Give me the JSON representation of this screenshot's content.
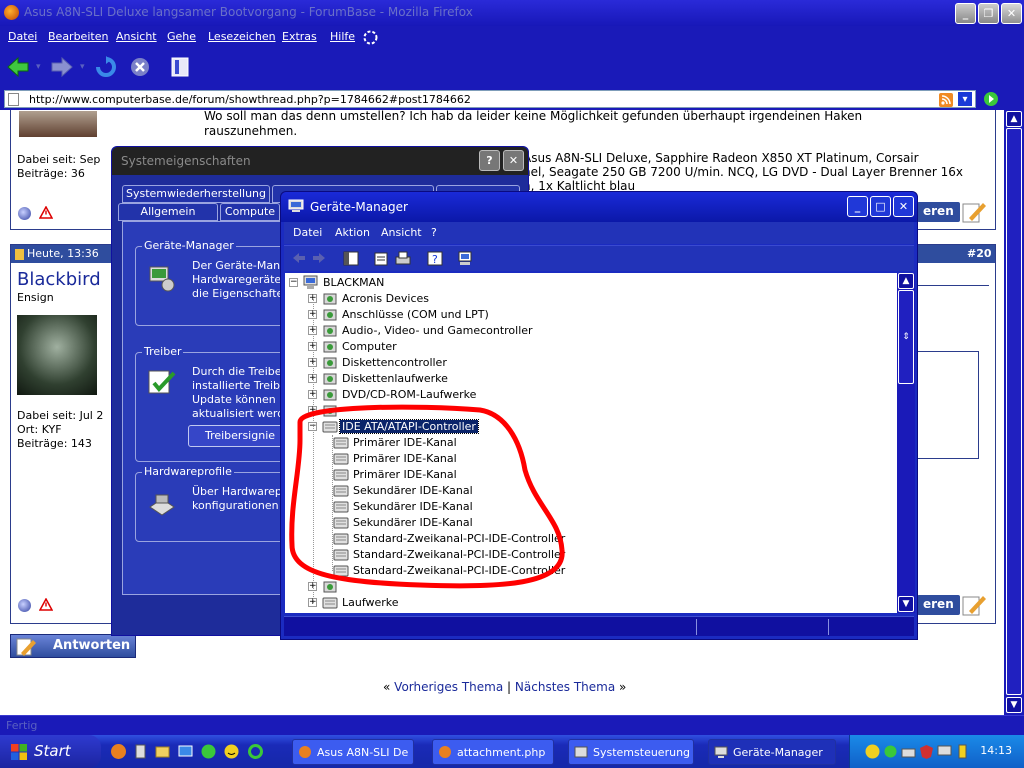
{
  "browser": {
    "title": "Asus A8N-SLI Deluxe langsamer Bootvorgang - ForumBase - Mozilla Firefox",
    "menu": [
      "Datei",
      "Bearbeiten",
      "Ansicht",
      "Gehe",
      "Lesezeichen",
      "Extras",
      "Hilfe"
    ],
    "url": "http://www.computerbase.de/forum/showthread.php?p=1784662#post1784662",
    "status": "Fertig"
  },
  "page": {
    "post1_text_lines": [
      "Wo soll man das denn umstellen? Ich hab da leider keine Möglichkeit gefunden überhaupt irgendeinen Haken",
      "rauszunehmen."
    ],
    "post1_user_lines": [
      "Dabei seit: Sep",
      "Beiträge: 36"
    ],
    "post1_sig_lines": [
      "Asus A8N-SLI Deluxe, Sapphire Radeon X850 XT Platinum, Corsair",
      "nel, Seagate 250 GB 7200 U/min. NCQ, LG DVD - Dual Layer Brenner 16x",
      "n, 1x Kaltlicht blau"
    ],
    "post2_date": "Heute, 13:36",
    "post2_number": "#20",
    "post2_username": "Blackbird",
    "post2_rank": "Ensign",
    "post2_user_lines": [
      "Dabei seit: Jul 2",
      "Ort: KYF",
      "Beiträge: 143"
    ],
    "edit_label": "eren",
    "reply_label": "Antworten",
    "nav_prev": "Vorheriges Thema",
    "nav_sep": "|",
    "nav_next": "Nächstes Thema",
    "nav_left_mark": "«",
    "nav_right_mark": "»"
  },
  "sysprops": {
    "title": "Systemeigenschaften",
    "tabs_row1": [
      "Systemwiederherstellung"
    ],
    "tabs_row2": [
      "Allgemein",
      "Compute"
    ],
    "groups": [
      {
        "legend": "Geräte-Manager",
        "lines": [
          "Der Geräte-Manag",
          "Hardwaregeräte a",
          "die Eigenschaften"
        ]
      },
      {
        "legend": "Treiber",
        "lines": [
          "Durch die Treibers",
          "installierte Treiber",
          "Update können Si",
          "aktualisiert werden"
        ],
        "button": "Treibersignie"
      },
      {
        "legend": "Hardwareprofile",
        "lines": [
          "Über Hardwarepro",
          "konfigurationen ei"
        ]
      }
    ]
  },
  "devmgr": {
    "title": "Geräte-Manager",
    "menu": [
      "Datei",
      "Aktion",
      "Ansicht",
      "?"
    ],
    "root": "BLACKMAN",
    "categories_top": [
      "Acronis Devices",
      "Anschlüsse (COM und LPT)",
      "Audio-, Video- und Gamecontroller",
      "Computer",
      "Diskettencontroller",
      "Diskettenlaufwerke",
      "DVD/CD-ROM-Laufwerke"
    ],
    "selected": "IDE ATA/ATAPI-Controller",
    "children": [
      "Primärer IDE-Kanal",
      "Primärer IDE-Kanal",
      "Primärer IDE-Kanal",
      "Sekundärer IDE-Kanal",
      "Sekundärer IDE-Kanal",
      "Sekundärer IDE-Kanal",
      "Standard-Zweikanal-PCI-IDE-Controller",
      "Standard-Zweikanal-PCI-IDE-Controller",
      "Standard-Zweikanal-PCI-IDE-Controller"
    ],
    "categories_bottom": [
      "Laufwerke"
    ]
  },
  "taskbar": {
    "start": "Start",
    "tasks": [
      "Asus A8N-SLI De...",
      "attachment.php ...",
      "Systemsteuerung",
      "Geräte-Manager"
    ],
    "clock": "14:13"
  },
  "colors": {
    "annotation": "#ff0000",
    "selection": "#0a246a",
    "xp_blue": "#1a1ab8"
  }
}
